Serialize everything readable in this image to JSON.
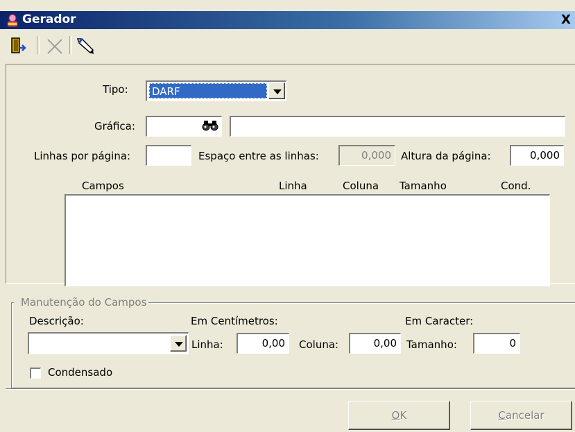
{
  "window": {
    "title": "Gerador",
    "close_label": "X"
  },
  "toolbar": {
    "icons": [
      "exit-door-icon",
      "delete-x-icon",
      "edit-pen-icon"
    ]
  },
  "form": {
    "tipo_label": "Tipo:",
    "tipo_value": "DARF",
    "grafica_label": "Gráfica:",
    "grafica_code": "",
    "grafica_name": "",
    "linhas_label": "Linhas por página:",
    "linhas_value": "",
    "espaco_label": "Espaço entre as linhas:",
    "espaco_value": "0,000",
    "altura_label": "Altura da página:",
    "altura_value": "0,000"
  },
  "fields_table": {
    "columns": [
      "Campos",
      "Linha",
      "Coluna",
      "Tamanho",
      "Cond."
    ],
    "rows": []
  },
  "group": {
    "title": "Manutenção do Campos",
    "descricao_label": "Descrição:",
    "descricao_value": "",
    "em_cm_label": "Em Centímetros:",
    "linha_label": "Linha:",
    "linha_value": "0,00",
    "coluna_label": "Coluna:",
    "coluna_value": "0,00",
    "em_caracter_label": "Em Caracter:",
    "tamanho_label": "Tamanho:",
    "tamanho_value": "0",
    "condensado_label": "Condensado",
    "condensado_checked": false
  },
  "buttons": {
    "ok_hotkey": "O",
    "ok_rest": "K",
    "cancel_hotkey": "C",
    "cancel_rest": "ancelar"
  }
}
